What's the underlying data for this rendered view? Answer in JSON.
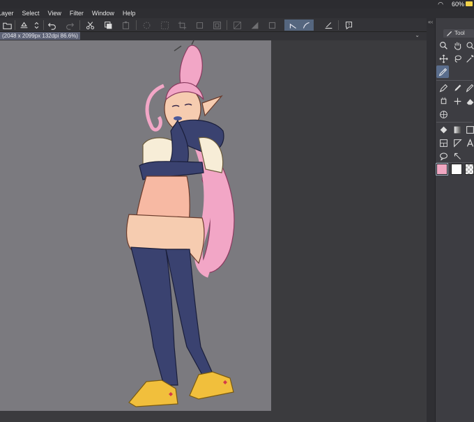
{
  "status": {
    "battery": "60%"
  },
  "menu": [
    "Layer",
    "Select",
    "View",
    "Filter",
    "Window",
    "Help"
  ],
  "document": {
    "tab_label": "(2048 x 2099px 132dpi 86.6%)"
  },
  "panel": {
    "tab_label": "Tool"
  },
  "colors": {
    "main": "#f0a7c2",
    "sub": "#ffffff",
    "transparent": "checker"
  }
}
